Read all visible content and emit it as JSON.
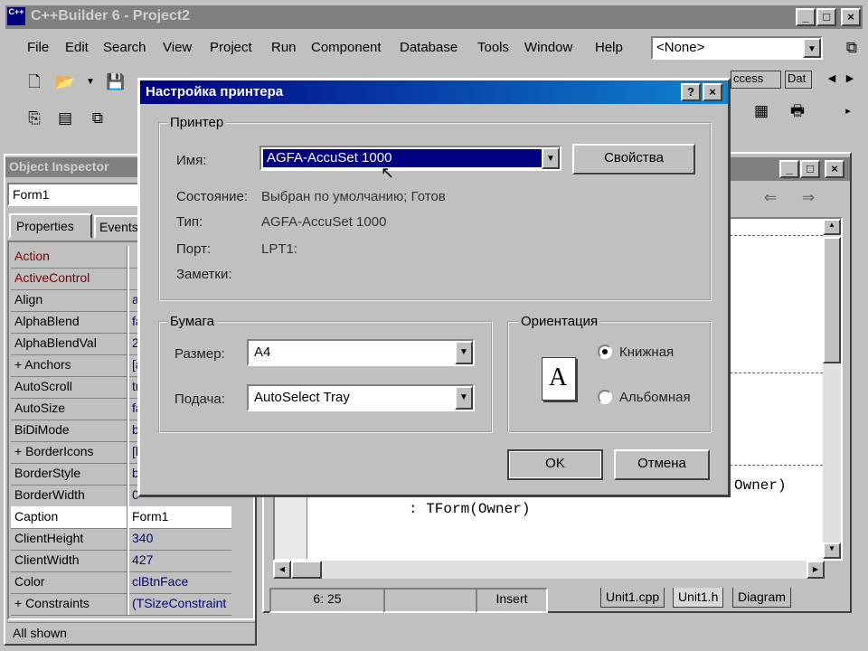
{
  "app": {
    "title": "C++Builder 6 - Project2"
  },
  "menu": [
    "File",
    "Edit",
    "Search",
    "View",
    "Project",
    "Run",
    "Component",
    "Database",
    "Tools",
    "Window",
    "Help"
  ],
  "toolbar": {
    "combo_value": "<None>"
  },
  "palette": {
    "tab1": "ccess",
    "tab2": "Dat"
  },
  "object_inspector": {
    "title": "Object Inspector",
    "selector": "Form1",
    "tabs": {
      "properties": "Properties",
      "events": "Events"
    },
    "rows": [
      {
        "name": "Action",
        "value": "",
        "color": "#800000"
      },
      {
        "name": "ActiveControl",
        "value": "",
        "color": "#800000"
      },
      {
        "name": "Align",
        "value": "a",
        "color": ""
      },
      {
        "name": "AlphaBlend",
        "value": "fa",
        "color": ""
      },
      {
        "name": "AlphaBlendVal",
        "value": "2",
        "color": ""
      },
      {
        "name": "+ Anchors",
        "value": "[a",
        "color": ""
      },
      {
        "name": "AutoScroll",
        "value": "tr",
        "color": ""
      },
      {
        "name": "AutoSize",
        "value": "fa",
        "color": ""
      },
      {
        "name": "BiDiMode",
        "value": "b",
        "color": ""
      },
      {
        "name": "+ BorderIcons",
        "value": "[b",
        "color": ""
      },
      {
        "name": "BorderStyle",
        "value": "b",
        "color": ""
      },
      {
        "name": "BorderWidth",
        "value": "0",
        "color": ""
      },
      {
        "name": "Caption",
        "value": "Form1",
        "color": ""
      },
      {
        "name": "ClientHeight",
        "value": "340",
        "color": ""
      },
      {
        "name": "ClientWidth",
        "value": "427",
        "color": ""
      },
      {
        "name": "Color",
        "value": "clBtnFace",
        "color": ""
      },
      {
        "name": "+ Constraints",
        "value": "(TSizeConstraint",
        "color": ""
      }
    ],
    "status": "All shown"
  },
  "editor": {
    "code_line1": "Owner)",
    "code_line2": ": TForm(Owner)",
    "position": "6: 25",
    "mode": "Insert",
    "tabs": [
      "Unit1.cpp",
      "Unit1.h",
      "Diagram"
    ]
  },
  "dialog": {
    "title": "Настройка принтера",
    "printer_group": "Принтер",
    "name_label": "Имя:",
    "name_value": "AGFA-AccuSet 1000",
    "properties_button": "Свойства",
    "status_label": "Состояние:",
    "status_value": "Выбран по умолчанию; Готов",
    "type_label": "Тип:",
    "type_value": "AGFA-AccuSet 1000",
    "port_label": "Порт:",
    "port_value": "LPT1:",
    "comment_label": "Заметки:",
    "paper_group": "Бумага",
    "size_label": "Размер:",
    "size_value": "A4",
    "source_label": "Подача:",
    "source_value": "AutoSelect Tray",
    "orientation_group": "Ориентация",
    "portrait_label": "Книжная",
    "landscape_label": "Альбомная",
    "ok_button": "OK",
    "cancel_button": "Отмена",
    "orientation_glyph": "A"
  }
}
